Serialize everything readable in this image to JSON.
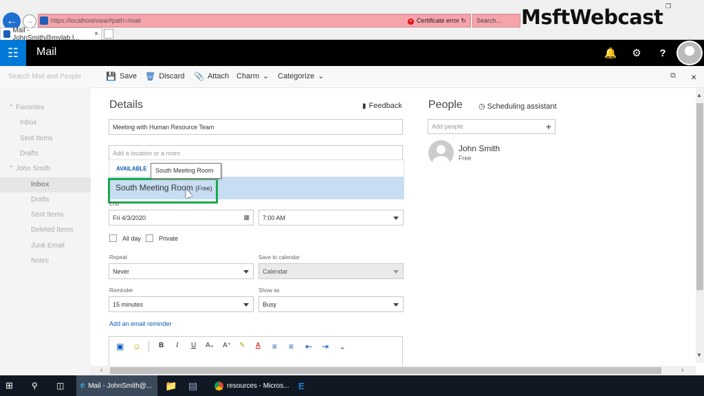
{
  "browser": {
    "url": "https://localhost/owa/#path=/mail",
    "url_host": "localhost",
    "cert_error": "Certificate error",
    "search_placeholder": "Search...",
    "tab_title": "Mail - JohnSmith@mylab.l...",
    "brand": "MsftWebcast"
  },
  "header": {
    "app_name": "Mail"
  },
  "leftnav": {
    "search_placeholder": "Search Mail and People",
    "items": [
      {
        "label": "Favorites",
        "indent": 0
      },
      {
        "label": "Inbox",
        "indent": 1
      },
      {
        "label": "Sent Items",
        "indent": 1
      },
      {
        "label": "Drafts",
        "indent": 1
      },
      {
        "label": "John Smith",
        "indent": 0
      },
      {
        "label": "Inbox",
        "indent": 2
      },
      {
        "label": "Drafts",
        "indent": 2
      },
      {
        "label": "Sent Items",
        "indent": 2
      },
      {
        "label": "Deleted Items",
        "indent": 2
      },
      {
        "label": "Junk Email",
        "indent": 2
      },
      {
        "label": "Notes",
        "indent": 2
      }
    ]
  },
  "toolbar": {
    "save": "Save",
    "discard": "Discard",
    "attach": "Attach",
    "charm": "Charm",
    "categorize": "Categorize"
  },
  "details": {
    "title": "Details",
    "feedback": "Feedback",
    "subject": "Meeting with Human Resource Team",
    "location_placeholder": "Add a location or a room",
    "available_label": "AVAILABLE",
    "tooltip": "South Meeting Room",
    "suggestion_room": "South Meeting Room",
    "suggestion_status": "(Free)",
    "end_label": "End",
    "end_date": "Fri 4/3/2020",
    "end_time": "7:00 AM",
    "all_day": "All day",
    "private": "Private",
    "repeat_label": "Repeat",
    "repeat_value": "Never",
    "save_to_calendar_label": "Save to calendar",
    "save_to_calendar_value": "Calendar",
    "reminder_label": "Reminder",
    "reminder_value": "15 minutes",
    "show_as_label": "Show as",
    "show_as_value": "Busy",
    "email_reminder": "Add an email reminder"
  },
  "people": {
    "title": "People",
    "scheduling": "Scheduling assistant",
    "add_placeholder": "Add people",
    "attendee_name": "John Smith",
    "attendee_status": "Free"
  },
  "taskbar": {
    "ie_label": "Mail - JohnSmith@...",
    "chrome_label": "resources - Micros..."
  }
}
